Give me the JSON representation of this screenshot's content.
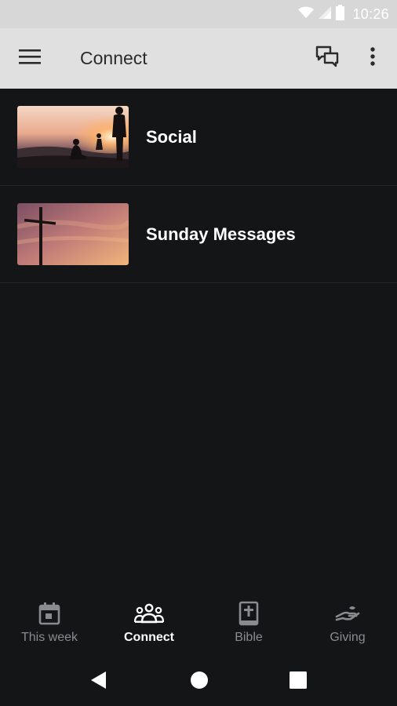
{
  "status_bar": {
    "time": "10:26",
    "icons": [
      "wifi-icon",
      "signal-icon",
      "battery-icon"
    ]
  },
  "app_bar": {
    "title": "Connect",
    "actions": [
      "menu-icon",
      "chat-icon",
      "more-vert-icon"
    ]
  },
  "list": {
    "items": [
      {
        "label": "Social",
        "thumbnail": "sunset-people-image"
      },
      {
        "label": "Sunday Messages",
        "thumbnail": "cross-sunset-image"
      }
    ]
  },
  "bottom_nav": {
    "tabs": [
      {
        "label": "This week",
        "icon": "calendar-icon",
        "active": false
      },
      {
        "label": "Connect",
        "icon": "group-icon",
        "active": true
      },
      {
        "label": "Bible",
        "icon": "bible-icon",
        "active": false
      },
      {
        "label": "Giving",
        "icon": "giving-hand-icon",
        "active": false
      }
    ]
  },
  "system_nav": {
    "buttons": [
      "back-icon",
      "home-icon",
      "recents-icon"
    ]
  },
  "colors": {
    "background": "#141517",
    "app_bar": "#e0e0e0",
    "status_bar": "#d7d7d7",
    "active_tab": "#ffffff",
    "inactive_tab": "#8a8b8e"
  }
}
